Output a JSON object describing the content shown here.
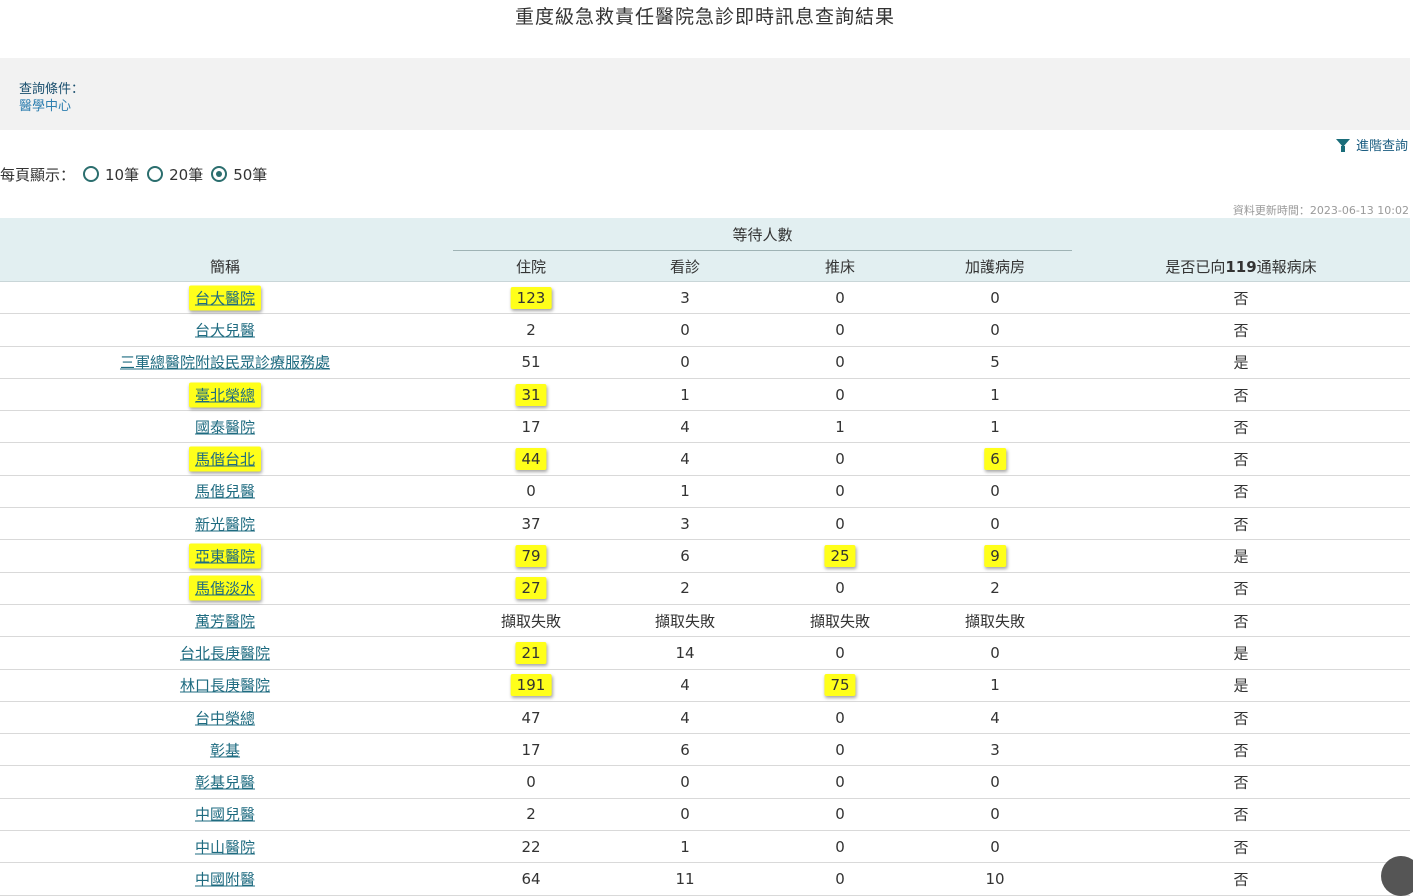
{
  "page_title": "重度級急救責任醫院急診即時訊息查詢結果",
  "criteria": {
    "label": "查詢條件：",
    "value": "醫學中心"
  },
  "advanced_search": "進階查詢",
  "per_page": {
    "label": "每頁顯示：",
    "options": [
      "10筆",
      "20筆",
      "50筆"
    ],
    "selected": "50筆"
  },
  "updated": "資料更新時間：2023-06-13 10:02",
  "table": {
    "group_header": "等待人數",
    "headers": {
      "name": "簡稱",
      "inpatient": "住院",
      "consult": "看診",
      "bed": "推床",
      "icu": "加護病房",
      "reported_pre": "是否已向",
      "reported_num": "119",
      "reported_post": "通報病床"
    },
    "rows": [
      {
        "name": "台大醫院",
        "inpatient": "123",
        "consult": "3",
        "bed": "0",
        "icu": "0",
        "reported": "否",
        "hl": [
          "name",
          "inpatient"
        ]
      },
      {
        "name": "台大兒醫",
        "inpatient": "2",
        "consult": "0",
        "bed": "0",
        "icu": "0",
        "reported": "否",
        "hl": []
      },
      {
        "name": "三軍總醫院附設民眾診療服務處",
        "inpatient": "51",
        "consult": "0",
        "bed": "0",
        "icu": "5",
        "reported": "是",
        "hl": []
      },
      {
        "name": "臺北榮總",
        "inpatient": "31",
        "consult": "1",
        "bed": "0",
        "icu": "1",
        "reported": "否",
        "hl": [
          "name",
          "inpatient"
        ]
      },
      {
        "name": "國泰醫院",
        "inpatient": "17",
        "consult": "4",
        "bed": "1",
        "icu": "1",
        "reported": "否",
        "hl": []
      },
      {
        "name": "馬偕台北",
        "inpatient": "44",
        "consult": "4",
        "bed": "0",
        "icu": "6",
        "reported": "否",
        "hl": [
          "name",
          "inpatient",
          "icu"
        ]
      },
      {
        "name": "馬偕兒醫",
        "inpatient": "0",
        "consult": "1",
        "bed": "0",
        "icu": "0",
        "reported": "否",
        "hl": []
      },
      {
        "name": "新光醫院",
        "inpatient": "37",
        "consult": "3",
        "bed": "0",
        "icu": "0",
        "reported": "否",
        "hl": []
      },
      {
        "name": "亞東醫院",
        "inpatient": "79",
        "consult": "6",
        "bed": "25",
        "icu": "9",
        "reported": "是",
        "hl": [
          "name",
          "inpatient",
          "bed",
          "icu"
        ]
      },
      {
        "name": "馬偕淡水",
        "inpatient": "27",
        "consult": "2",
        "bed": "0",
        "icu": "2",
        "reported": "否",
        "hl": [
          "name",
          "inpatient"
        ]
      },
      {
        "name": "萬芳醫院",
        "inpatient": "擷取失敗",
        "consult": "擷取失敗",
        "bed": "擷取失敗",
        "icu": "擷取失敗",
        "reported": "否",
        "hl": []
      },
      {
        "name": "台北長庚醫院",
        "inpatient": "21",
        "consult": "14",
        "bed": "0",
        "icu": "0",
        "reported": "是",
        "hl": [
          "inpatient"
        ]
      },
      {
        "name": "林口長庚醫院",
        "inpatient": "191",
        "consult": "4",
        "bed": "75",
        "icu": "1",
        "reported": "是",
        "hl": [
          "inpatient",
          "bed"
        ]
      },
      {
        "name": "台中榮總",
        "inpatient": "47",
        "consult": "4",
        "bed": "0",
        "icu": "4",
        "reported": "否",
        "hl": []
      },
      {
        "name": "彰基",
        "inpatient": "17",
        "consult": "6",
        "bed": "0",
        "icu": "3",
        "reported": "否",
        "hl": []
      },
      {
        "name": "彰基兒醫",
        "inpatient": "0",
        "consult": "0",
        "bed": "0",
        "icu": "0",
        "reported": "否",
        "hl": []
      },
      {
        "name": "中國兒醫",
        "inpatient": "2",
        "consult": "0",
        "bed": "0",
        "icu": "0",
        "reported": "否",
        "hl": []
      },
      {
        "name": "中山醫院",
        "inpatient": "22",
        "consult": "1",
        "bed": "0",
        "icu": "0",
        "reported": "否",
        "hl": []
      },
      {
        "name": "中國附醫",
        "inpatient": "64",
        "consult": "11",
        "bed": "0",
        "icu": "10",
        "reported": "否",
        "hl": []
      }
    ]
  }
}
